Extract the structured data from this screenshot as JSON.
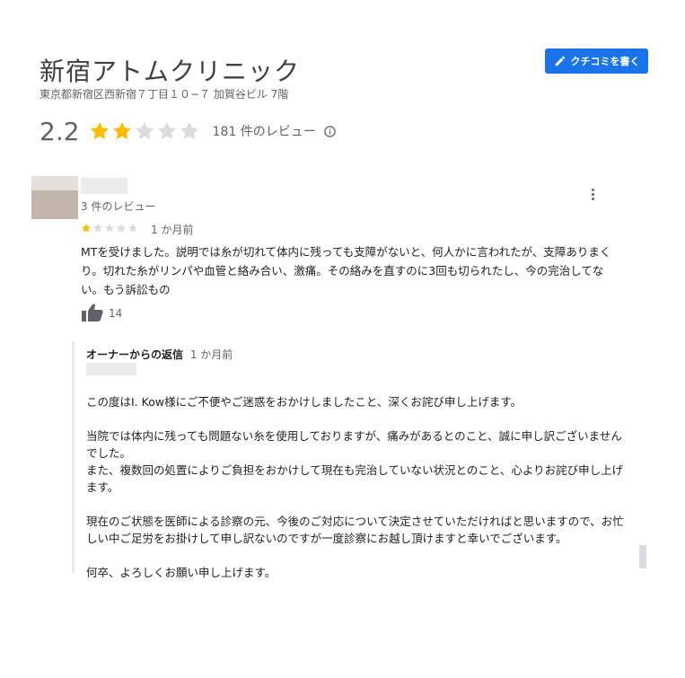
{
  "place": {
    "name": "新宿アトムクリニック",
    "address": "東京都新宿区西新宿７丁目１０−７ 加賀谷ビル 7階",
    "rating": "2.2",
    "stars": 2,
    "review_count": "181 件のレビュー"
  },
  "actions": {
    "write_review_label": "クチコミを書く"
  },
  "review": {
    "reviewer_review_count": "3 件のレビュー",
    "stars": 1,
    "date": "1 か月前",
    "text": "MTを受けました。説明では糸が切れて体内に残っても支障がないと、何人かに言われたが、支障ありまくり。切れた糸がリンパや血管と絡み合い、激痛。その絡みを直すのに3回も切られたし、今の完治してない。もう訴訟もの",
    "likes": "14"
  },
  "owner_reply": {
    "heading": "オーナーからの返信",
    "date": "1 か月前",
    "paragraphs": [
      "この度はI. Kow様にご不便やご迷惑をおかけしましたこと、深くお詫び申し上げます。",
      "当院では体内に残っても問題ない糸を使用しておりますが、痛みがあるとのこと、誠に申し訳ございませんでした。",
      "また、複数回の処置によりご負担をおかけして現在も完治していない状況とのこと、心よりお詫び申し上げます。",
      "現在のご状態を医師による診察の元、今後のご対応について決定させていただければと思いますので、お忙しい中ご足労をお掛けして申し訳ないのですが一度診察にお越し頂けますと幸いでございます。",
      "何卒、よろしくお願い申し上げます。"
    ]
  },
  "colors": {
    "accent": "#1a73e8",
    "star_filled": "#fbbc04",
    "star_empty": "#dadce0"
  }
}
